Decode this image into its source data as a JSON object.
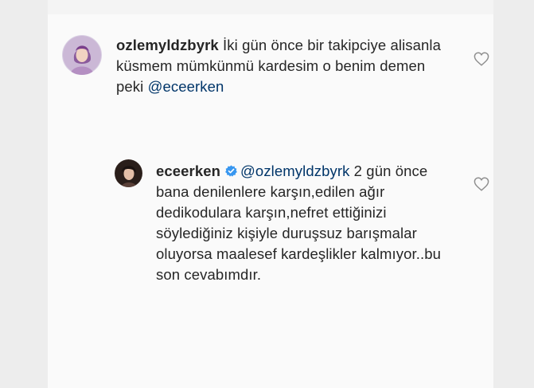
{
  "comments": [
    {
      "username": "ozlemyldzbyrk",
      "text_before": "İki gün önce bir takipciye alisanla küsmem mümkünmü kardesim o benim demen peki ",
      "mention": "@eceerken",
      "text_after": "",
      "verified": false,
      "avatar_icon": "avatar-photo-icon",
      "like_icon": "heart-outline-icon"
    },
    {
      "username": "eceerken",
      "verified": true,
      "verified_icon": "verified-badge-icon",
      "mention": "@ozlemyldzbyrk",
      "text_after": " 2 gün önce bana denilenlere karşın,edilen ağır dedikodulara karşın,nefret ettiğinizi söylediğiniz kişiyle duruşsuz barışmalar oluyorsa maalesef kardeşlikler kalmıyor..bu son cevabımdır.",
      "avatar_icon": "avatar-photo-icon",
      "like_icon": "heart-outline-icon"
    }
  ],
  "colors": {
    "text": "#262626",
    "mention": "#003569",
    "verified": "#3897f0",
    "panel": "#fafafa",
    "outer": "#ededed",
    "heart": "#8e8e8e"
  }
}
